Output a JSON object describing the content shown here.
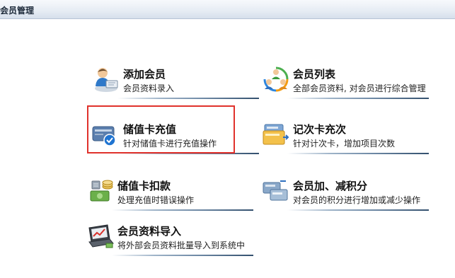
{
  "window": {
    "title": "会员管理"
  },
  "items": [
    {
      "label": "添加会员",
      "desc": "会员资料录入",
      "icon": "add-member-icon"
    },
    {
      "label": "会员列表",
      "desc": "全部会员资料, 对会员进行综合管理",
      "icon": "member-list-icon"
    },
    {
      "label": "储值卡充值",
      "desc": "针对储值卡进行充值操作",
      "icon": "stored-card-icon"
    },
    {
      "label": "记次卡充次",
      "desc": "针对计次卡，增加项目次数",
      "icon": "count-card-icon"
    },
    {
      "label": "储值卡扣款",
      "desc": "处理充值时错误操作",
      "icon": "deduct-money-icon"
    },
    {
      "label": "会员加、减积分",
      "desc": "对会员的积分进行增加或减少操作",
      "icon": "points-adjust-icon"
    },
    {
      "label": "会员资料导入",
      "desc": "将外部会员资料批量导入到系统中",
      "icon": "import-laptop-icon"
    }
  ],
  "highlight_color": "#e0322c"
}
